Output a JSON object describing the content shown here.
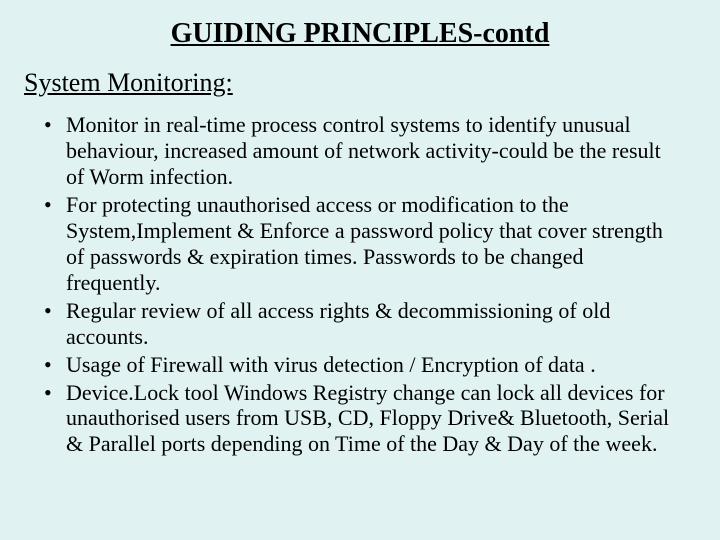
{
  "title": "GUIDING PRINCIPLES-contd",
  "subheading": "System Monitoring:",
  "bullets": [
    "Monitor in real-time process control systems to identify unusual behaviour, increased amount of network activity-could be the result of Worm infection.",
    "For protecting unauthorised access or modification to the System,Implement & Enforce a password policy that cover strength of passwords & expiration times.  Passwords to be changed frequently.",
    "Regular review of all access rights & decommissioning of old accounts.",
    "Usage of Firewall with virus detection  / Encryption of data .",
    "Device.Lock tool Windows Registry change can lock all devices for unauthorised users from USB, CD, Floppy Drive& Bluetooth, Serial & Parallel ports depending on Time of the Day  & Day of the week."
  ]
}
